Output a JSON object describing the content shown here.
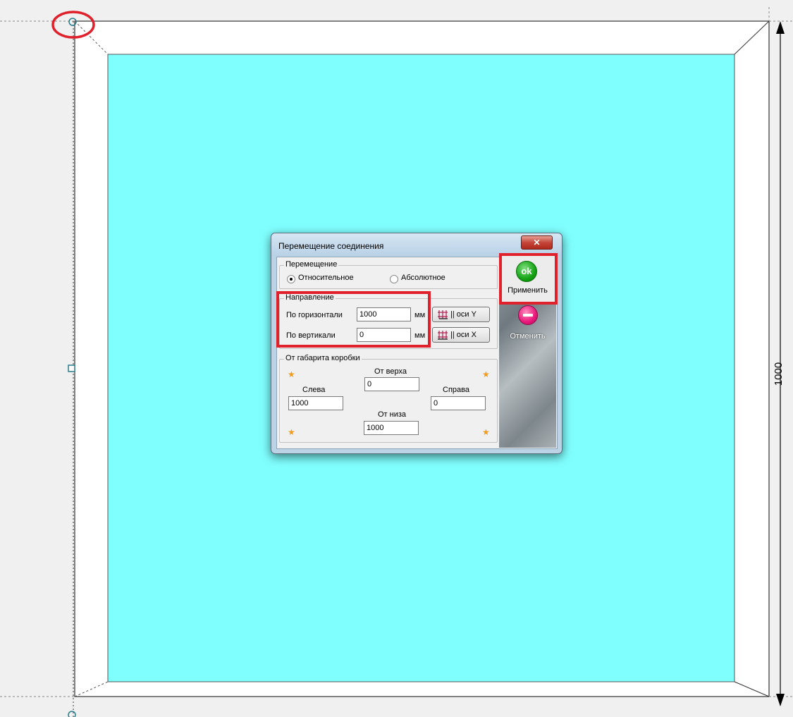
{
  "drawing": {
    "dimension_label": "1000",
    "colors": {
      "glass": "#80ffff",
      "frame": "#ffffff",
      "background": "#f0f0f0",
      "highlight": "#e0202a"
    }
  },
  "dialog": {
    "title": "Перемещение соединения",
    "close_icon": "✕",
    "movement_group": {
      "label": "Перемещение",
      "options": [
        "Относительное",
        "Абсолютное"
      ],
      "selected": "Относительное"
    },
    "direction_group": {
      "label": "Направление",
      "horizontal_label": "По горизонтали",
      "horizontal_value": "1000",
      "vertical_label": "По вертикали",
      "vertical_value": "0",
      "unit": "мм",
      "axis_y_button": "|| оси Y",
      "axis_x_button": "|| оси X"
    },
    "box_group": {
      "label": "От габарита коробки",
      "top_label": "От верха",
      "top_value": "0",
      "left_label": "Слева",
      "left_value": "1000",
      "right_label": "Справа",
      "right_value": "0",
      "bottom_label": "От низа",
      "bottom_value": "1000"
    },
    "apply_icon_text": "ok",
    "apply_label": "Применить",
    "cancel_label": "Отменить"
  }
}
